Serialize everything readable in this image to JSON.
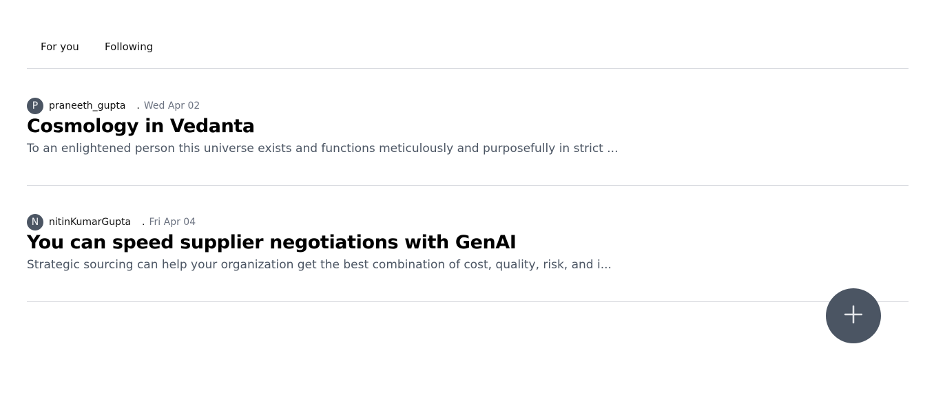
{
  "tabs": [
    {
      "label": "For you"
    },
    {
      "label": "Following"
    }
  ],
  "posts": [
    {
      "avatar_initial": "P",
      "author": "praneeth_gupta",
      "separator": ".",
      "date": "Wed Apr 02",
      "title": "Cosmology in Vedanta",
      "excerpt": "To an enlightened person this universe exists and functions meticulously and purposefully in strict ..."
    },
    {
      "avatar_initial": "N",
      "author": "nitinKumarGupta",
      "separator": ".",
      "date": "Fri Apr 04",
      "title": "You can speed supplier negotiations with GenAI",
      "excerpt": "Strategic sourcing can help your organization get the best combination of cost, quality, risk, and i..."
    }
  ],
  "fab": {
    "icon": "plus-icon",
    "icon_color": "#e5e7eb",
    "background": "#4b5563"
  },
  "colors": {
    "avatar_bg": "#4b5563",
    "divider": "#d9dbe0",
    "excerpt_text": "#4b5563",
    "date_text": "#6b7280"
  }
}
